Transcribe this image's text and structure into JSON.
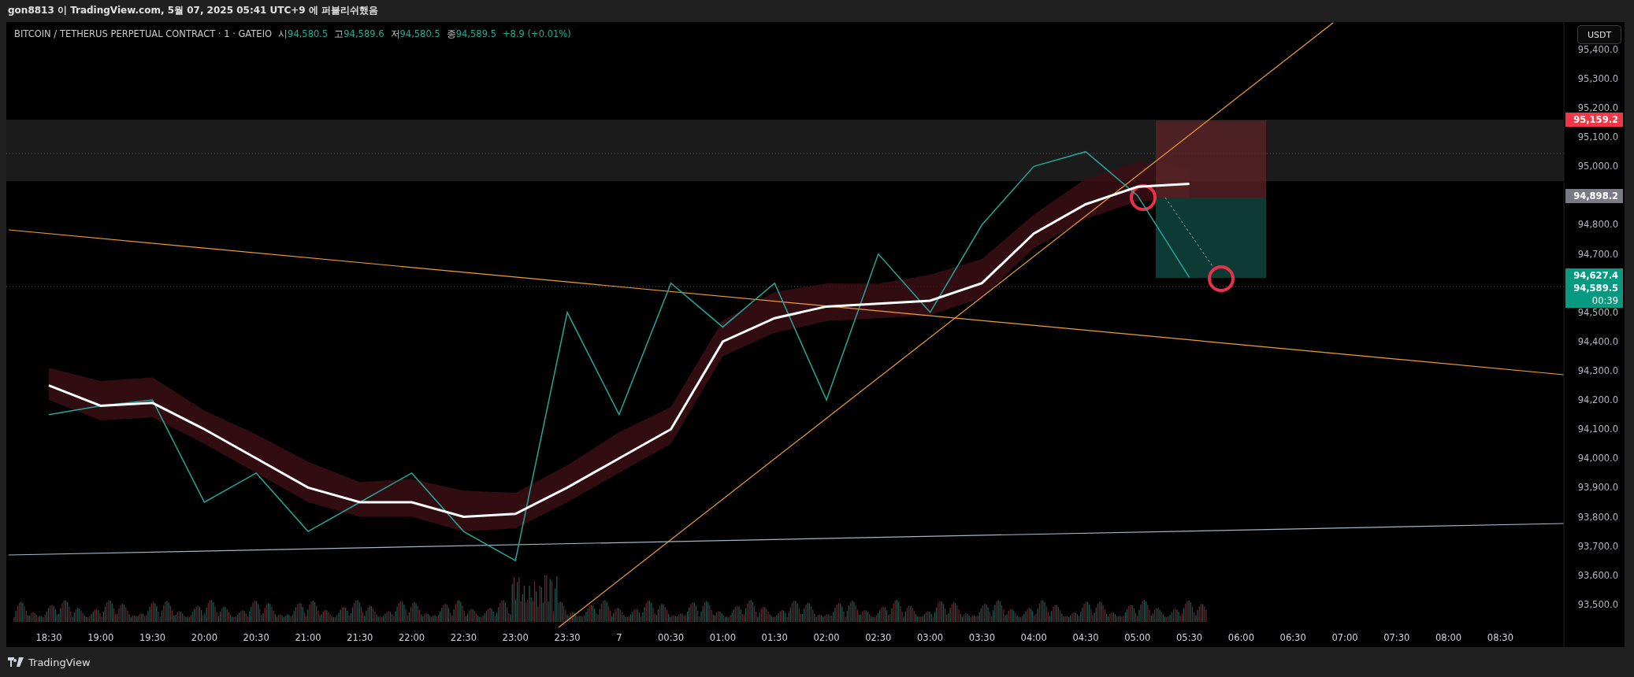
{
  "publish_line": "gon8813 이 TradingView.com, 5월 07, 2025 05:41 UTC+9 에 퍼블리쉬했음",
  "legend": {
    "symbol": "BITCOIN / TETHERUS PERPETUAL CONTRACT · 1 · GATEIO",
    "ohlc": [
      {
        "label": "시",
        "value": "94,580.5"
      },
      {
        "label": "고",
        "value": "94,589.6"
      },
      {
        "label": "저",
        "value": "94,580.5"
      },
      {
        "label": "종",
        "value": "94,589.5"
      }
    ],
    "change": "+8.9 (+0.01%)"
  },
  "currency_button": "USDT",
  "price_labels": [
    {
      "text": "95,159.2",
      "color": "#f23645"
    },
    {
      "text": "94,898.2",
      "color": "#787b86"
    },
    {
      "text": "94,627.4",
      "color": "#089981"
    },
    {
      "text": "94,589.5",
      "color": "#089981",
      "countdown": "00:39"
    }
  ],
  "chart_data": {
    "type": "line",
    "categories": [
      "18:30",
      "19:00",
      "19:30",
      "20:00",
      "20:30",
      "21:00",
      "21:30",
      "22:00",
      "22:30",
      "23:00",
      "23:30",
      "7",
      "00:30",
      "01:00",
      "01:30",
      "02:00",
      "02:30",
      "03:00",
      "03:30",
      "04:00",
      "04:30",
      "05:00",
      "05:30",
      "06:00",
      "06:30",
      "07:00",
      "07:30",
      "08:00",
      "08:30"
    ],
    "series": [
      {
        "color": "#26a69a",
        "values": [
          94150,
          94180,
          94200,
          93850,
          93950,
          93750,
          93850,
          93950,
          93750,
          93650,
          94500,
          94150,
          94600,
          94450,
          94600,
          94200,
          94700,
          94500,
          94800,
          95000,
          95050,
          94900,
          94620,
          null,
          null,
          null,
          null,
          null,
          null
        ]
      },
      {
        "color": "#ffffff",
        "values": [
          94250,
          94180,
          94190,
          94100,
          94000,
          93900,
          93850,
          93850,
          93800,
          93810,
          93900,
          94000,
          94100,
          94400,
          94480,
          94520,
          94530,
          94540,
          94600,
          94770,
          94870,
          94930,
          94940,
          null,
          null,
          null,
          null,
          null,
          null
        ]
      }
    ],
    "ylim": [
      93354,
      95494
    ],
    "yticks": [
      {
        "value": 95400,
        "label": "95,400.0"
      },
      {
        "value": 95300,
        "label": "95,300.0"
      },
      {
        "value": 95200,
        "label": "95,200.0"
      },
      {
        "value": 95100,
        "label": "95,100.0"
      },
      {
        "value": 95000,
        "label": "95,000.0"
      },
      {
        "value": 94800,
        "label": "94,800.0"
      },
      {
        "value": 94700,
        "label": "94,700.0"
      },
      {
        "value": 94500,
        "label": "94,500.0"
      },
      {
        "value": 94400,
        "label": "94,400.0"
      },
      {
        "value": 94300,
        "label": "94,300.0"
      },
      {
        "value": 94200,
        "label": "94,200.0"
      },
      {
        "value": 94100,
        "label": "94,100.0"
      },
      {
        "value": 94000,
        "label": "94,000.0"
      },
      {
        "value": 93900,
        "label": "93,900.0"
      },
      {
        "value": 93800,
        "label": "93,800.0"
      },
      {
        "value": 93700,
        "label": "93,700.0"
      },
      {
        "value": 93600,
        "label": "93,600.0"
      },
      {
        "value": 93500,
        "label": "93,500.0"
      }
    ]
  },
  "footer_brand": "TradingView"
}
